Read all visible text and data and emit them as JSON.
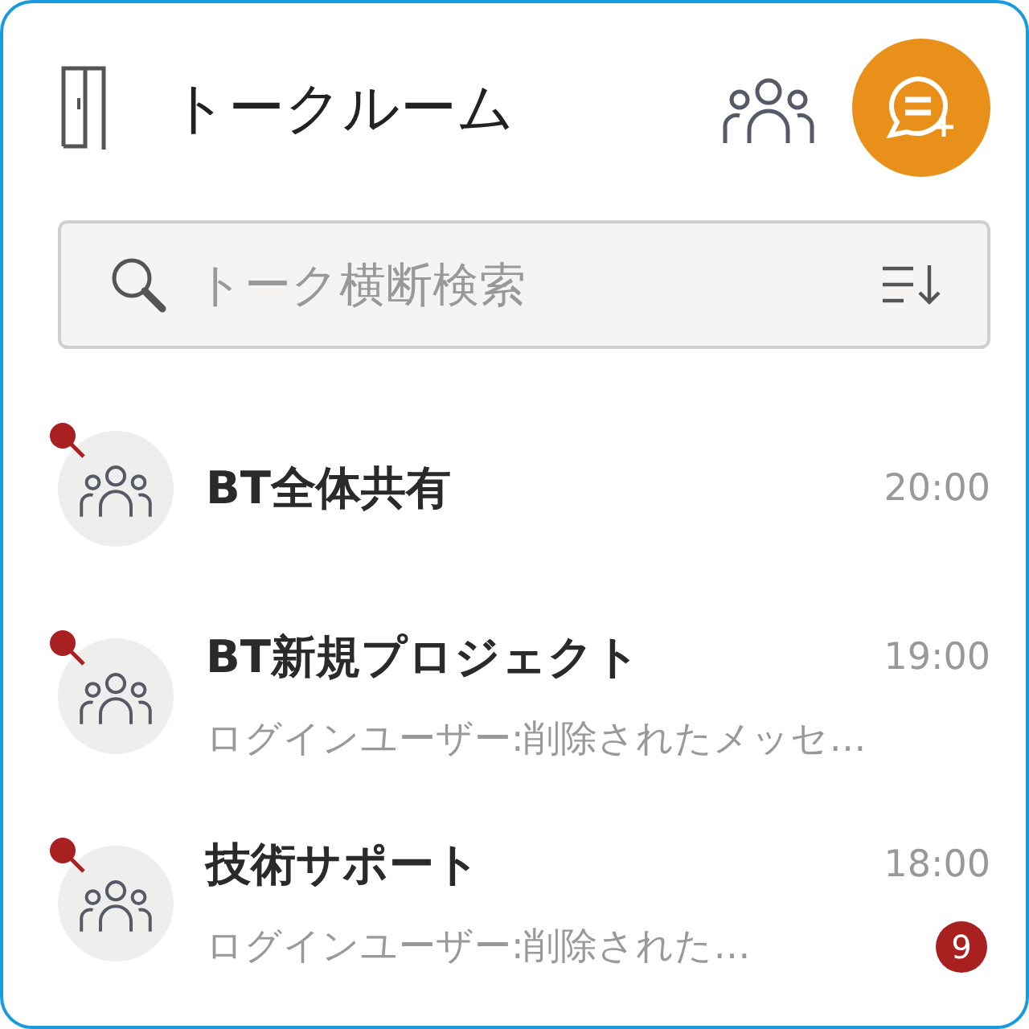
{
  "header": {
    "title": "トークルーム"
  },
  "search": {
    "placeholder": "トーク横断検索"
  },
  "rooms": [
    {
      "name": "BT全体共有",
      "time": "20:00",
      "pinned": true
    },
    {
      "name": "BT新規プロジェクト",
      "time": "19:00",
      "preview": "ログインユーザー:削除されたメッセ…",
      "pinned": true
    },
    {
      "name": "技術サポート",
      "time": "18:00",
      "preview": "ログインユーザー:削除された…",
      "pinned": true,
      "unread": "9"
    }
  ]
}
